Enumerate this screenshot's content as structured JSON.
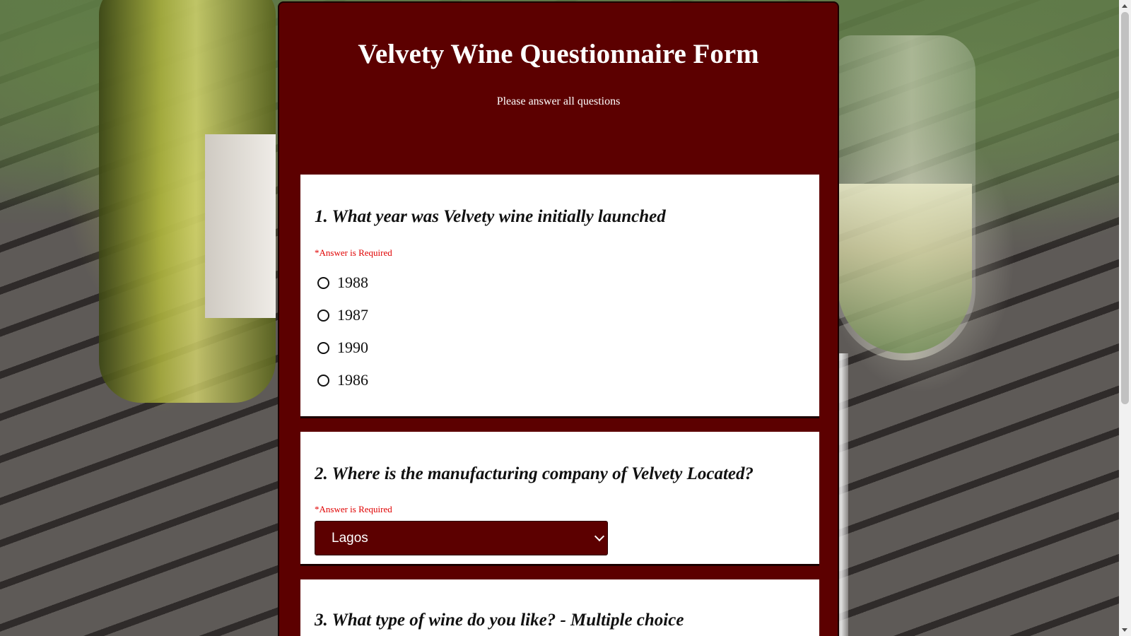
{
  "form": {
    "title": "Velvety Wine Questionnaire Form",
    "subtitle": "Please answer all questions",
    "colors": {
      "form_background": "#5c0000",
      "card_background": "#ffffff",
      "required_text": "#e00000",
      "select_background": "#5c0000"
    }
  },
  "questions": [
    {
      "text": "1. What year was Velvety wine initially launched",
      "required_note": "*Answer is Required",
      "type": "radio",
      "options": [
        "1988",
        "1987",
        "1990",
        "1986"
      ]
    },
    {
      "text": "2. Where is the manufacturing company of Velvety Located?",
      "required_note": "*Answer is Required",
      "type": "select",
      "selected": "Lagos",
      "icon": "chevron-down-icon"
    },
    {
      "text": "3. What type of wine do you like? - Multiple choice"
    }
  ],
  "scrollbar": {
    "icons": [
      "scroll-up-arrow-icon",
      "scroll-down-arrow-icon"
    ]
  }
}
